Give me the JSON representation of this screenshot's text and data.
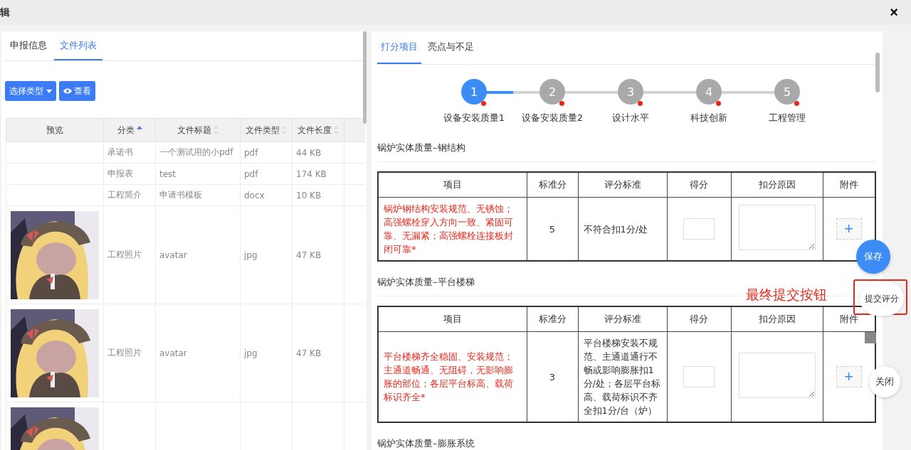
{
  "window": {
    "title": "辑",
    "close": "×"
  },
  "left_tabs": [
    {
      "label": "申报信息",
      "selected": false
    },
    {
      "label": "文件列表",
      "selected": true
    }
  ],
  "toolbar": {
    "type_button": "选择类型",
    "view_button": "查看"
  },
  "file_table": {
    "columns": [
      {
        "label": "预览"
      },
      {
        "label": "分类",
        "sorted_asc": true
      },
      {
        "label": "文件标题",
        "sorted_asc": false
      },
      {
        "label": "文件类型",
        "sorted_asc": false
      },
      {
        "label": "文件长度",
        "sorted_asc": false
      }
    ],
    "rows": [
      {
        "category": "承诺书",
        "title": "一个测试用的小pdf",
        "type": "pdf",
        "size": "44 KB"
      },
      {
        "category": "申报表",
        "title": "test",
        "type": "pdf",
        "size": "174 KB"
      },
      {
        "category": "工程简介",
        "title": "申请书模板",
        "type": "docx",
        "size": "10 KB"
      },
      {
        "preview": {
          "kind": "picture"
        },
        "category": "工程照片",
        "title": "avatar",
        "type": "jpg",
        "size": "47 KB"
      },
      {
        "preview": {
          "kind": "picture"
        },
        "category": "工程照片",
        "title": "avatar",
        "type": "jpg",
        "size": "47 KB"
      },
      {
        "preview": {
          "kind": "picture"
        }
      }
    ]
  },
  "right_tabs": [
    {
      "label": "打分项目",
      "selected": true
    },
    {
      "label": "亮点与不足",
      "selected": false
    }
  ],
  "steps": [
    {
      "number": "1",
      "label": "设备安装质量1",
      "selected": true,
      "flagged": true
    },
    {
      "number": "2",
      "label": "设备安装质量2",
      "selected": false,
      "flagged": true
    },
    {
      "number": "3",
      "label": "设计水平",
      "selected": false,
      "flagged": true
    },
    {
      "number": "4",
      "label": "科技创新",
      "selected": false,
      "flagged": true
    },
    {
      "number": "5",
      "label": "工程管理",
      "selected": false,
      "flagged": true
    }
  ],
  "sections": [
    {
      "title": "锅炉实体质量–钢结构",
      "columns": [
        "项目",
        "标准分",
        "评分标准",
        "得分",
        "扣分原因",
        "附件"
      ],
      "rows": [
        {
          "item": "锅炉钢结构安装规范、无锈蚀；高强螺栓穿入方向一致、紧固可靠、无漏紧；高强螺栓连接板封闭可靠*",
          "standard_score": "5",
          "criteria": "不符合扣1分/处",
          "upload": "+"
        }
      ]
    },
    {
      "title": "锅炉实体质量–平台楼梯",
      "columns": [
        "项目",
        "标准分",
        "评分标准",
        "得分",
        "扣分原因",
        "附件"
      ],
      "rows": [
        {
          "item": "平台楼梯齐全稳固、安装规范；主通道畅通、无阻碍，无影响膨胀的部位；各层平台标高、载荷标识齐全*",
          "standard_score": "3",
          "criteria": "平台楼梯安装不规范、主通道通行不畅或影响膨胀扣1分/处；各层平台标高、载荷标识不齐全扣1分/台（炉）",
          "upload": "+"
        }
      ]
    },
    {
      "title": "锅炉实体质量–膨胀系统"
    }
  ],
  "float_buttons": {
    "save": "保存",
    "submit": "提交评分",
    "close": "关闭"
  },
  "annotation": "最终提交按钮"
}
